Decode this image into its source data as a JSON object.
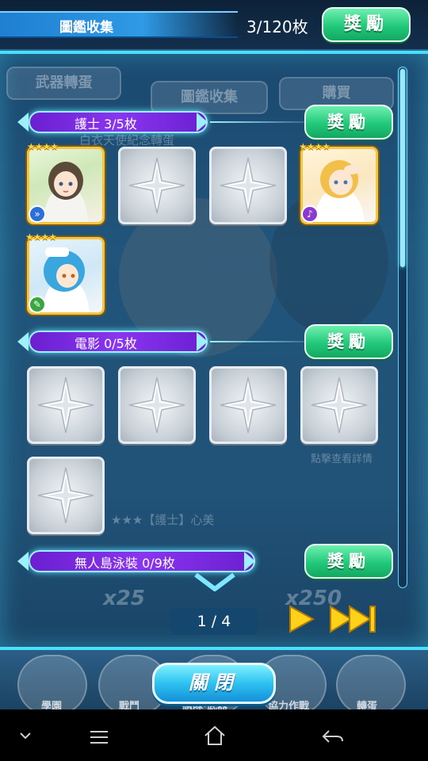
{
  "header": {
    "title": "圖鑑收集",
    "counter": "3/120枚",
    "reward_label": "獎勵"
  },
  "background_tabs": [
    "武器轉蛋",
    "圖鑑收集",
    "購買"
  ],
  "categories": [
    {
      "label": "護士 3/5枚",
      "reward_label": "獎勵"
    },
    {
      "label": "電影 0/5枚",
      "reward_label": "獎勵"
    },
    {
      "label": "無人島泳裝 0/9枚",
      "reward_label": "獎勵"
    }
  ],
  "card_stars": "★★★★",
  "ghost_texts": {
    "nurse_subtitle": "白衣天使紀念轉蛋",
    "detail_hint": "點擊查看詳情",
    "nurse_name": "★★★【護士】心美",
    "multiplier_1": "x25",
    "multiplier_2": "x250"
  },
  "pager": {
    "text": "1 / 4"
  },
  "close_label": "關閉",
  "bottom_nav": [
    "學園",
    "戰鬥",
    "組隊·武器",
    "協力作戰",
    "轉蛋"
  ],
  "colors": {
    "accent": "#47e0ff",
    "reward_green": "#22c97a",
    "banner_purple": "#8a35f0",
    "star_gold": "#ffd43a"
  },
  "icons": {
    "next": "play-triangle-icon",
    "last": "fast-forward-icon",
    "sys_back": "back-arrow-icon",
    "sys_home": "home-icon",
    "sys_menu": "menu-icon",
    "sys_down": "chevron-down-icon"
  }
}
